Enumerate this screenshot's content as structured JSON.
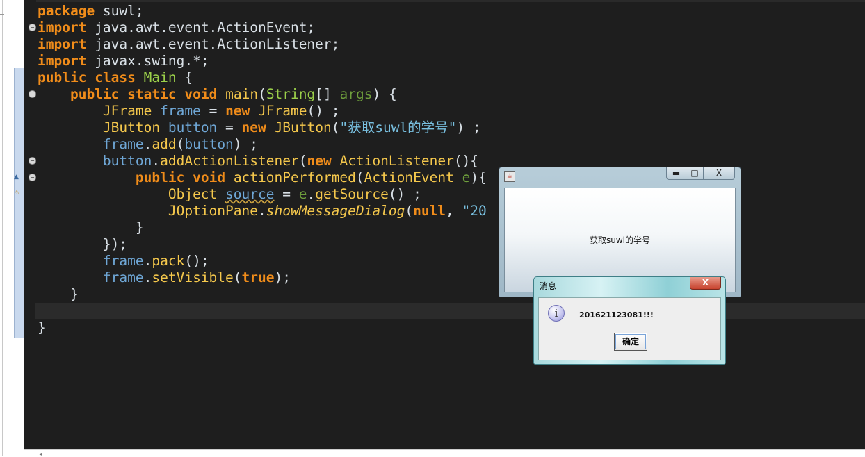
{
  "code": {
    "line1": {
      "kw": "package",
      "rest": " suwl;"
    },
    "line2": {
      "kw": "import",
      "rest": " java.awt.event.ActionEvent;"
    },
    "line3": {
      "kw": "import",
      "rest": " java.awt.event.ActionListener;"
    },
    "line4": {
      "kw": "import",
      "rest": " javax.swing.*;"
    },
    "line5": {
      "kw1": "public",
      "kw2": "class",
      "cls": "Main",
      "rest": " {"
    },
    "line6": {
      "kw1": "public",
      "kw2": "static",
      "kw3": "void",
      "met": "main",
      "p1": "(",
      "typ": "String",
      "p2": "[] ",
      "arg": "args",
      "rest": ") {"
    },
    "line7": {
      "cls": "JFrame",
      "var": "frame",
      "eq": " = ",
      "kw": "new",
      "cls2": "JFrame",
      "rest": "() ;"
    },
    "line8": {
      "cls": "JButton",
      "var": "button",
      "eq": " = ",
      "kw": "new",
      "cls2": "JButton",
      "p1": "(",
      "str": "\"获取suwl的学号\"",
      "rest": ") ;"
    },
    "line9": {
      "var": "frame",
      "dot": ".",
      "met": "add",
      "p1": "(",
      "var2": "button",
      "rest": ") ;"
    },
    "line10": {
      "var": "button",
      "dot": ".",
      "met": "addActionListener",
      "p1": "(",
      "kw": "new",
      "cls": "ActionListener",
      "rest": "(){"
    },
    "line11": {
      "kw1": "public",
      "kw2": "void",
      "met": "actionPerformed",
      "p1": "(",
      "cls": "ActionEvent",
      "arg": "e",
      "rest": "){"
    },
    "line12": {
      "cls": "Object",
      "var": "source",
      "eq": " = ",
      "var2": "e",
      "dot": ".",
      "met": "getSource",
      "rest": "() ;"
    },
    "line13": {
      "cls": "JOptionPane",
      "dot": ".",
      "met": "showMessageDialog",
      "p1": "(",
      "kw": "null",
      "comma": ", ",
      "str": "\"20"
    },
    "line14": {
      "rest": "}"
    },
    "line15": {
      "rest": "});"
    },
    "line16": {
      "var": "frame",
      "dot": ".",
      "met": "pack",
      "rest": "();"
    },
    "line17": {
      "var": "frame",
      "dot": ".",
      "met": "setVisible",
      "p1": "(",
      "kw": "true",
      "rest": ");"
    },
    "line18": {
      "rest": "}"
    },
    "line20": {
      "rest": "}"
    }
  },
  "jframe": {
    "button_label": "获取suwl的学号",
    "minimize_symbol": "▬",
    "maximize_symbol": "□",
    "close_symbol": "X"
  },
  "dialog": {
    "title": "消息",
    "close_symbol": "X",
    "icon_glyph": "i",
    "message": "201621123081!!!",
    "ok_label": "确定"
  }
}
